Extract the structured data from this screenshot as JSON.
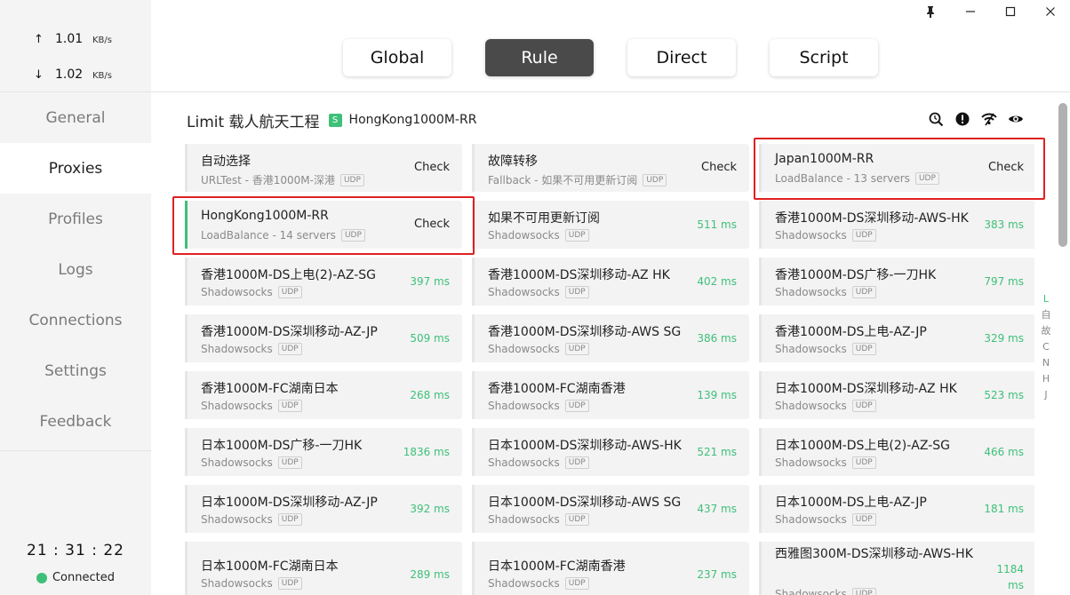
{
  "window": {
    "pin_icon": "pin-icon",
    "minimize_icon": "minimize-icon",
    "maximize_icon": "maximize-icon",
    "close_icon": "close-icon"
  },
  "traffic": {
    "up_arrow": "↑",
    "up_value": "1.01",
    "up_unit": "KB/s",
    "down_arrow": "↓",
    "down_value": "1.02",
    "down_unit": "KB/s"
  },
  "nav": [
    {
      "label": "General"
    },
    {
      "label": "Proxies"
    },
    {
      "label": "Profiles"
    },
    {
      "label": "Logs"
    },
    {
      "label": "Connections"
    },
    {
      "label": "Settings"
    },
    {
      "label": "Feedback"
    }
  ],
  "clock": "21 : 31 : 22",
  "status": "Connected",
  "modes": [
    {
      "label": "Global"
    },
    {
      "label": "Rule"
    },
    {
      "label": "Direct"
    },
    {
      "label": "Script"
    }
  ],
  "group": {
    "name": "Limit 载人航天工程",
    "badge": "S",
    "now": "HongKong1000M-RR"
  },
  "cards": [
    {
      "name": "自动选择",
      "meta": "URLTest - 香港1000M-深港",
      "udp": "UDP",
      "action": "Check"
    },
    {
      "name": "故障转移",
      "meta": "Fallback - 如果不可用更新订阅",
      "udp": "UDP",
      "action": "Check"
    },
    {
      "name": "Japan1000M-RR",
      "meta": "LoadBalance - 13 servers",
      "udp": "UDP",
      "action": "Check"
    },
    {
      "name": "HongKong1000M-RR",
      "meta": "LoadBalance - 14 servers",
      "udp": "UDP",
      "action": "Check"
    },
    {
      "name": "如果不可用更新订阅",
      "meta": "Shadowsocks",
      "udp": "UDP",
      "delay": "511 ms"
    },
    {
      "name": "香港1000M-DS深圳移动-AWS-HK",
      "meta": "Shadowsocks",
      "udp": "UDP",
      "delay": "383 ms"
    },
    {
      "name": "香港1000M-DS上电(2)-AZ-SG",
      "meta": "Shadowsocks",
      "udp": "UDP",
      "delay": "397 ms"
    },
    {
      "name": "香港1000M-DS深圳移动-AZ HK",
      "meta": "Shadowsocks",
      "udp": "UDP",
      "delay": "402 ms"
    },
    {
      "name": "香港1000M-DS广移-一刀HK",
      "meta": "Shadowsocks",
      "udp": "UDP",
      "delay": "797 ms"
    },
    {
      "name": "香港1000M-DS深圳移动-AZ-JP",
      "meta": "Shadowsocks",
      "udp": "UDP",
      "delay": "509 ms"
    },
    {
      "name": "香港1000M-DS深圳移动-AWS SG",
      "meta": "Shadowsocks",
      "udp": "UDP",
      "delay": "386 ms"
    },
    {
      "name": "香港1000M-DS上电-AZ-JP",
      "meta": "Shadowsocks",
      "udp": "UDP",
      "delay": "329 ms"
    },
    {
      "name": "香港1000M-FC湖南日本",
      "meta": "Shadowsocks",
      "udp": "UDP",
      "delay": "268 ms"
    },
    {
      "name": "香港1000M-FC湖南香港",
      "meta": "Shadowsocks",
      "udp": "UDP",
      "delay": "139 ms"
    },
    {
      "name": "日本1000M-DS深圳移动-AZ HK",
      "meta": "Shadowsocks",
      "udp": "UDP",
      "delay": "523 ms"
    },
    {
      "name": "日本1000M-DS广移-一刀HK",
      "meta": "Shadowsocks",
      "udp": "UDP",
      "delay": "1836 ms"
    },
    {
      "name": "日本1000M-DS深圳移动-AWS-HK",
      "meta": "Shadowsocks",
      "udp": "UDP",
      "delay": "521 ms"
    },
    {
      "name": "日本1000M-DS上电(2)-AZ-SG",
      "meta": "Shadowsocks",
      "udp": "UDP",
      "delay": "466 ms"
    },
    {
      "name": "日本1000M-DS深圳移动-AZ-JP",
      "meta": "Shadowsocks",
      "udp": "UDP",
      "delay": "392 ms"
    },
    {
      "name": "日本1000M-DS深圳移动-AWS SG",
      "meta": "Shadowsocks",
      "udp": "UDP",
      "delay": "437 ms"
    },
    {
      "name": "日本1000M-DS上电-AZ-JP",
      "meta": "Shadowsocks",
      "udp": "UDP",
      "delay": "181 ms"
    },
    {
      "name": "日本1000M-FC湖南日本",
      "meta": "Shadowsocks",
      "udp": "UDP",
      "delay": "289 ms"
    },
    {
      "name": "日本1000M-FC湖南香港",
      "meta": "Shadowsocks",
      "udp": "UDP",
      "delay": "237 ms"
    },
    {
      "name": "西雅图300M-DS深圳移动-AWS-HK",
      "meta": "Shadowsocks",
      "udp": "UDP",
      "delay": "1184 ms"
    }
  ],
  "index_letters": [
    "L",
    "自",
    "故",
    "C",
    "N",
    "H",
    "J"
  ],
  "colors": {
    "accent": "#3ec07a",
    "highlight": "#e02020",
    "active_mode": "#4a4a4a"
  }
}
